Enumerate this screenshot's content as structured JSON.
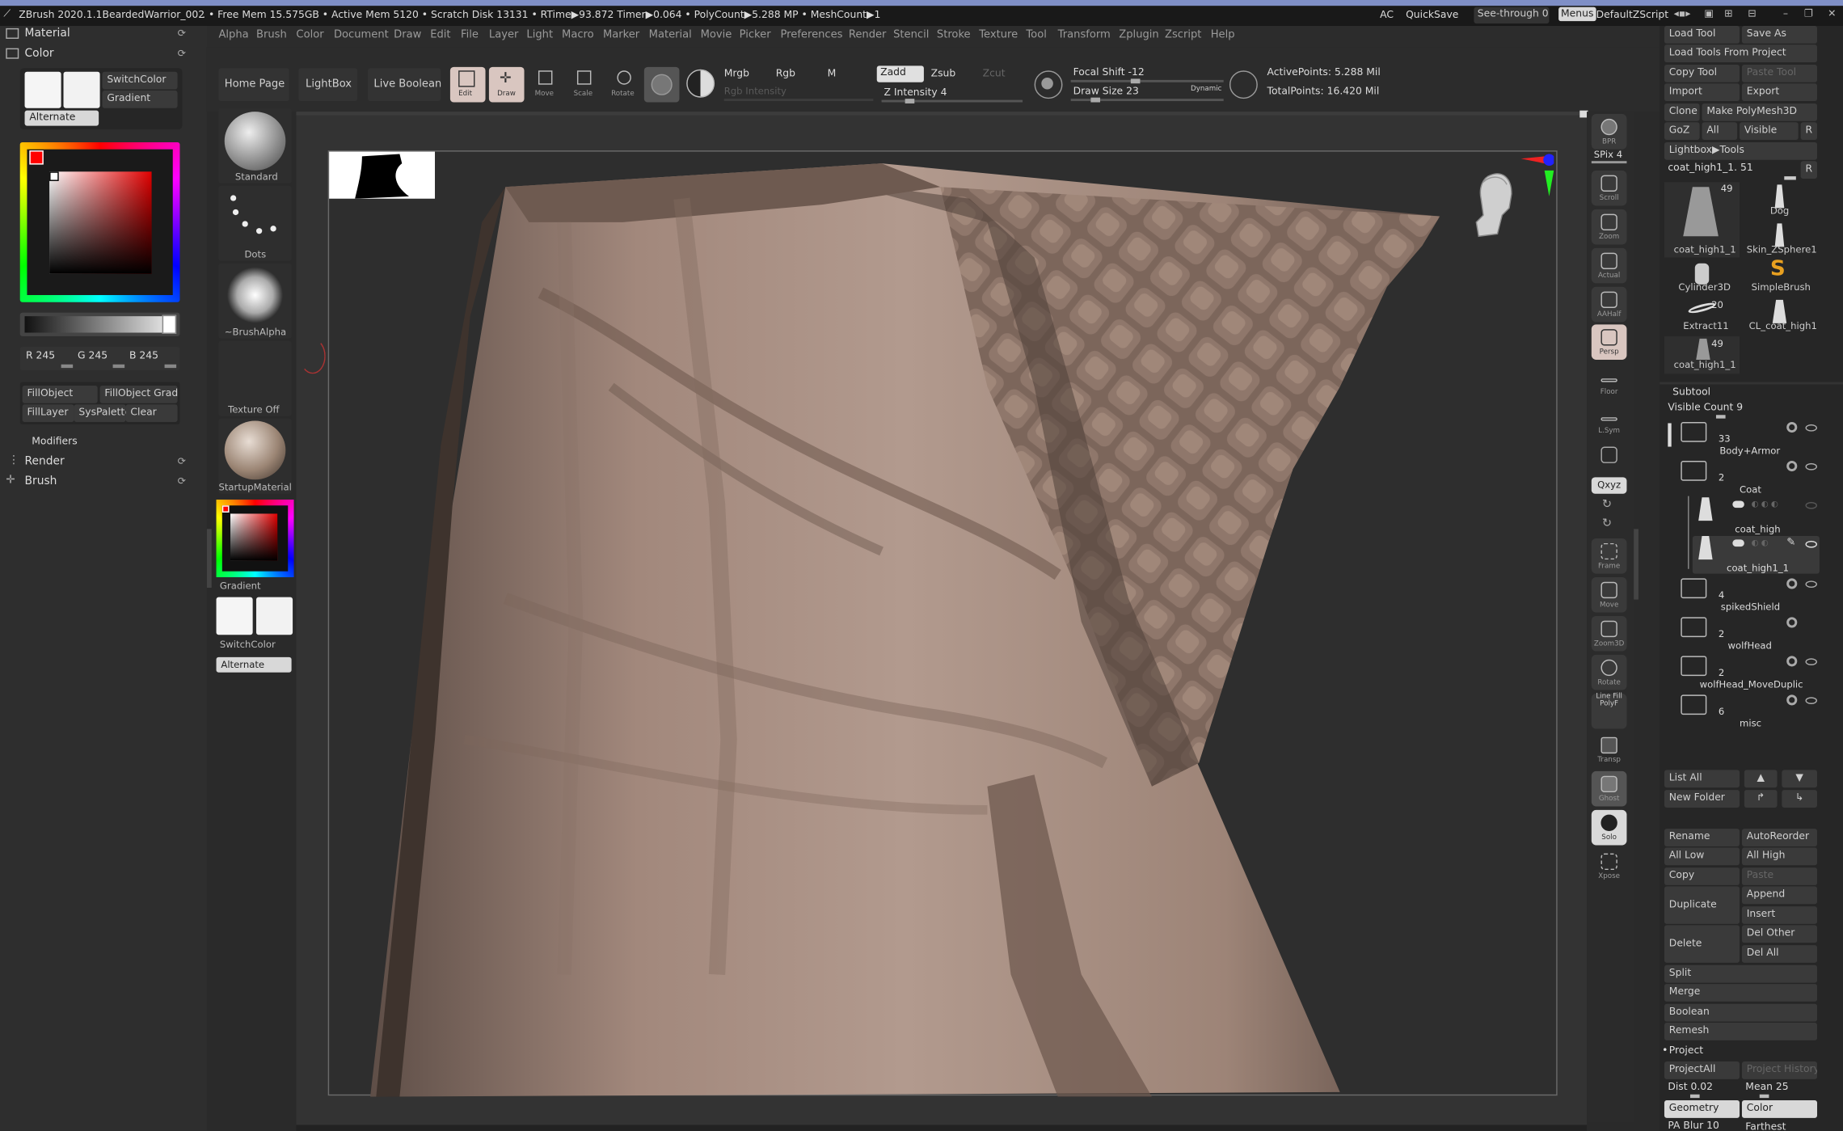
{
  "window": {
    "app": "ZBrush 2020.1.1",
    "document": "BeardedWarrior_002",
    "stats": ". • Free Mem 15.575GB • Active Mem 5120 • Scratch Disk 13131 •  RTime▶93.872 Timer▶0.064 • PolyCount▶5.288 MP  • MeshCount▶1",
    "ac": "AC",
    "quicksave": "QuickSave",
    "seethrough": "See-through  0",
    "menus": "Menus",
    "script": "DefaultZScript"
  },
  "menus": [
    "Alpha",
    "Brush",
    "Color",
    "Document",
    "Draw",
    "Edit",
    "File",
    "Layer",
    "Light",
    "Macro",
    "Marker",
    "Material",
    "Movie",
    "Picker",
    "Preferences",
    "Render",
    "Stencil",
    "Stroke",
    "Texture",
    "Tool",
    "Transform",
    "Zplugin",
    "Zscript",
    "Help"
  ],
  "left": {
    "material": "Material",
    "color": "Color",
    "switchcolor": "SwitchColor",
    "gradient": "Gradient",
    "alternate": "Alternate",
    "r": "R 245",
    "g": "G 245",
    "b": "B 245",
    "fillobject": "FillObject",
    "fillobjectgrad": "FillObject Grad",
    "filllayer": "FillLayer",
    "syspalette": "SysPalette",
    "clear": "Clear",
    "modifiers": "Modifiers",
    "render": "Render",
    "brush": "Brush"
  },
  "shelf": {
    "homepage": "Home Page",
    "lightbox": "LightBox",
    "liveboolean": "Live Boolean",
    "edit": "Edit",
    "draw": "Draw",
    "move": "Move",
    "scale": "Scale",
    "rotate": "Rotate",
    "mrgb": "Mrgb",
    "rgb": "Rgb",
    "m": "M",
    "rgbintensity": "Rgb Intensity",
    "zadd": "Zadd",
    "zsub": "Zsub",
    "zcut": "Zcut",
    "zintensity": "Z Intensity 4",
    "focal": "Focal Shift -12",
    "drawsize": "Draw Size 23",
    "dynamic": "Dynamic",
    "activepoints": "ActivePoints: 5.288 Mil",
    "totalpoints": "TotalPoints: 16.420 Mil"
  },
  "brushcol": {
    "standard": "Standard",
    "dots": "Dots",
    "alpha": "~BrushAlpha",
    "texture": "Texture Off",
    "material": "StartupMaterial",
    "gradient": "Gradient",
    "switchcolor": "SwitchColor",
    "alternate": "Alternate"
  },
  "righttools": [
    "BPR",
    "SPix 4",
    "Scroll",
    "Zoom",
    "Actual",
    "AAHalf",
    "Persp",
    "Floor",
    "L.Sym",
    "",
    "Qxyz",
    "",
    "",
    "Frame",
    "Move",
    "Zoom3D",
    "Rotate",
    "Line Fill PolyF",
    "Transp",
    "Ghost",
    "Solo",
    "Xpose"
  ],
  "tool": {
    "loadtool": "Load Tool",
    "saveas": "Save As",
    "loadfromproject": "Load Tools From Project",
    "copytool": "Copy Tool",
    "pastetool": "Paste Tool",
    "import": "Import",
    "export": "Export",
    "clone": "Clone",
    "makepolymesh": "Make PolyMesh3D",
    "goz": "GoZ",
    "all": "All",
    "visible": "Visible",
    "r": "R",
    "lightbox": "Lightbox▶Tools",
    "current": "coat_high1_1. 51",
    "thumbs": [
      {
        "name": "coat_high1_1",
        "count": "49"
      },
      {
        "name": "Dog",
        "count": ""
      },
      {
        "name": "Skin_ZSphere1",
        "count": ""
      },
      {
        "name": "Cylinder3D",
        "count": ""
      },
      {
        "name": "SimpleBrush",
        "count": ""
      },
      {
        "name": "Extract11",
        "count": "20"
      },
      {
        "name": "CL_coat_high1",
        "count": ""
      },
      {
        "name": "coat_high1_1",
        "count": "49"
      }
    ]
  },
  "subtool": {
    "title": "Subtool",
    "visible": "Visible Count 9",
    "items": [
      {
        "count": "33",
        "name": "Body+Armor"
      },
      {
        "count": "2",
        "name": "Coat"
      },
      {
        "count": "",
        "name": "coat_high"
      },
      {
        "count": "",
        "name": "coat_high1_1"
      },
      {
        "count": "4",
        "name": "spikedShield"
      },
      {
        "count": "2",
        "name": "wolfHead"
      },
      {
        "count": "2",
        "name": "wolfHead_MoveDuplic"
      },
      {
        "count": "6",
        "name": "misc"
      }
    ],
    "listall": "List All",
    "newfolder": "New Folder",
    "rename": "Rename",
    "autoreorder": "AutoReorder",
    "alllow": "All Low",
    "allhigh": "All High",
    "copy": "Copy",
    "paste": "Paste",
    "duplicate": "Duplicate",
    "append": "Append",
    "insert": "Insert",
    "delete": "Delete",
    "delother": "Del Other",
    "delall": "Del All",
    "split": "Split",
    "merge": "Merge",
    "boolean": "Boolean",
    "remesh": "Remesh",
    "project": "Project",
    "projectall": "ProjectAll",
    "projecthistory": "Project History",
    "dist": "Dist 0.02",
    "mean": "Mean 25",
    "geometry": "Geometry",
    "color": "Color",
    "pablur": "PA Blur 10",
    "farthest": "Farthest"
  },
  "colors": {
    "accent": "#7f8fc6",
    "leather": "#a58f84",
    "orange": "#e8a020"
  }
}
